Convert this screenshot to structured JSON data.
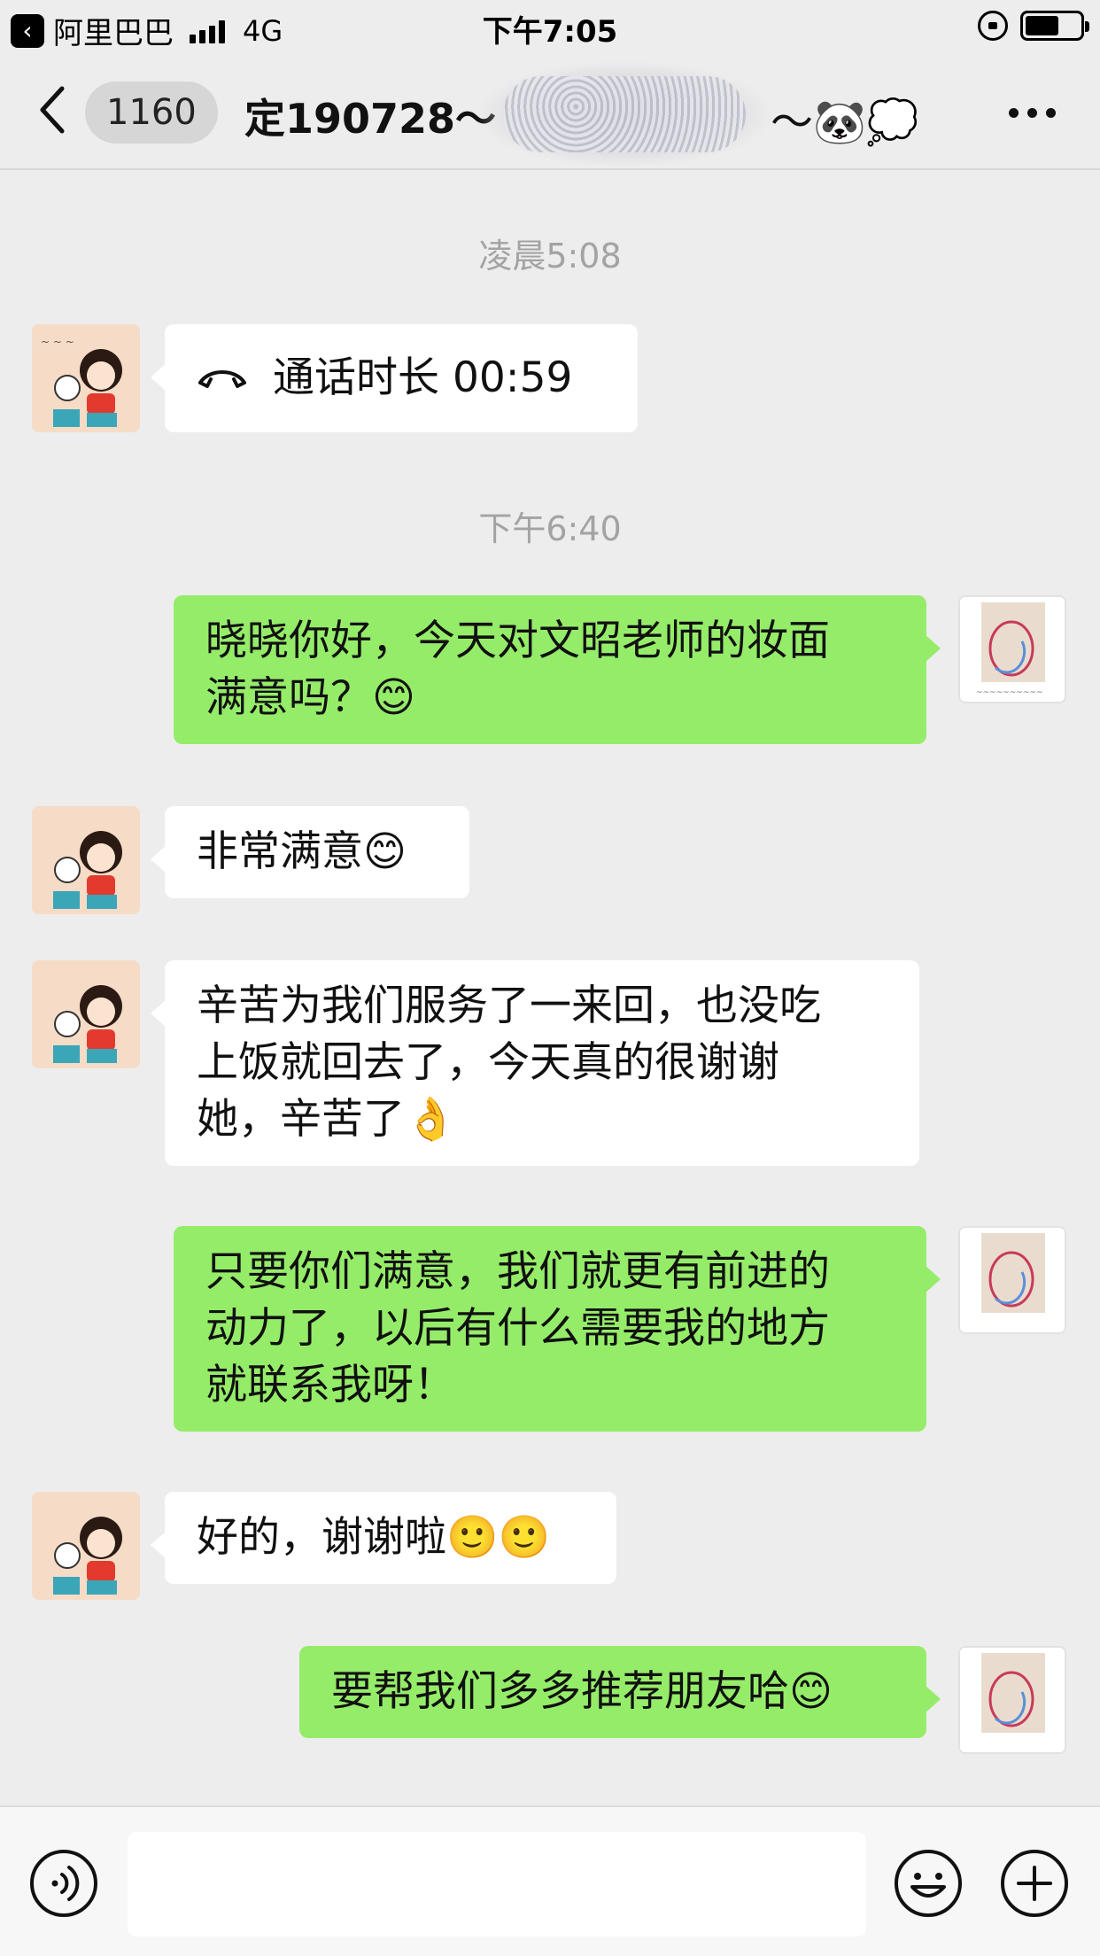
{
  "status_bar": {
    "back_app_icon": "chevron-left-icon",
    "carrier": "阿里巴巴",
    "network": "4G",
    "time": "下午7:05"
  },
  "nav": {
    "unread_count": "1160",
    "title": "定190728～",
    "title_suffix": "～🐼💭"
  },
  "messages": [
    {
      "type": "time",
      "text": "凌晨5:08"
    },
    {
      "type": "call",
      "direction": "in",
      "icon": "phone-hangup-icon",
      "text": "通话时长 00:59"
    },
    {
      "type": "time",
      "text": "下午6:40"
    },
    {
      "type": "text",
      "direction": "out",
      "lines": [
        "晓晓你好，今天对文昭老师的妆面",
        "满意吗？😊"
      ]
    },
    {
      "type": "text",
      "direction": "in",
      "lines": [
        "非常满意😊"
      ]
    },
    {
      "type": "text",
      "direction": "in",
      "lines": [
        "辛苦为我们服务了一来回，也没吃",
        "上饭就回去了，今天真的很谢谢",
        "她，辛苦了👌"
      ]
    },
    {
      "type": "text",
      "direction": "out",
      "lines": [
        "只要你们满意，我们就更有前进的",
        "动力了，以后有什么需要我的地方",
        "就联系我呀！"
      ]
    },
    {
      "type": "text",
      "direction": "in",
      "lines": [
        "好的，谢谢啦🙂🙂"
      ]
    },
    {
      "type": "text",
      "direction": "out",
      "lines": [
        "要帮我们多多推荐朋友哈😊"
      ]
    }
  ],
  "input_bar": {
    "voice_icon": "voice-icon",
    "emoji_icon": "emoji-icon",
    "plus_icon": "plus-icon",
    "value": ""
  },
  "colors": {
    "background": "#ededed",
    "outgoing_bubble": "#95ec69",
    "incoming_bubble": "#ffffff",
    "timestamp": "#a3a3a3"
  }
}
